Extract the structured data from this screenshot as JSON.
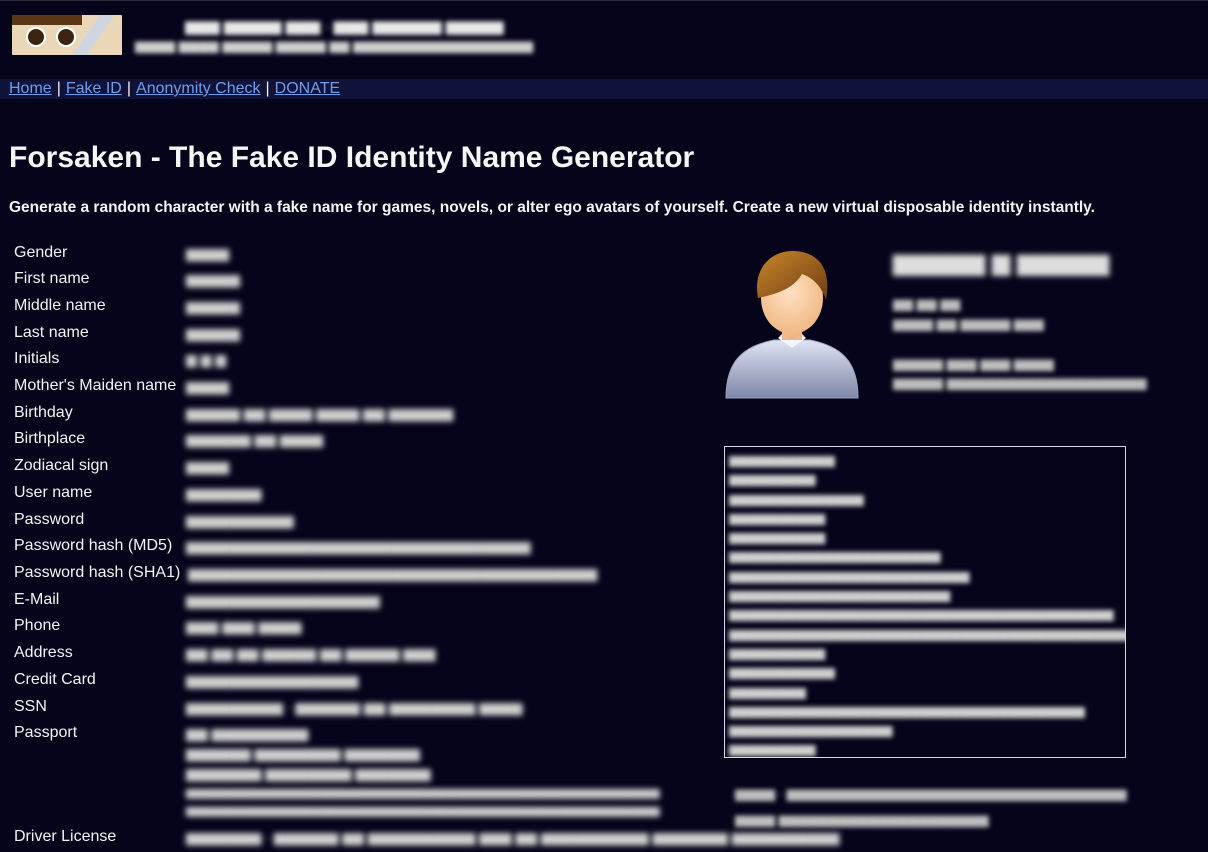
{
  "nav": {
    "links": [
      "Home",
      "Fake ID",
      "Anonymity Check",
      "DONATE"
    ],
    "separator": "|"
  },
  "page": {
    "title": "Forsaken - The Fake ID Identity Name Generator",
    "description": "Generate a random character with a fake name for games, novels, or alter ego avatars of yourself. Create a new virtual disposable identity instantly."
  },
  "fields": [
    {
      "label": "Gender"
    },
    {
      "label": "First name"
    },
    {
      "label": "Middle name"
    },
    {
      "label": "Last name"
    },
    {
      "label": "Initials"
    },
    {
      "label": "Mother's Maiden name"
    },
    {
      "label": "Birthday"
    },
    {
      "label": "Birthplace"
    },
    {
      "label": "Zodiacal sign"
    },
    {
      "label": "User name"
    },
    {
      "label": "Password"
    },
    {
      "label": "Password hash (MD5)"
    },
    {
      "label": "Password hash (SHA1)"
    },
    {
      "label": "E-Mail"
    },
    {
      "label": "Phone"
    },
    {
      "label": "Address"
    },
    {
      "label": "Credit Card"
    },
    {
      "label": "SSN"
    },
    {
      "label": "Passport"
    },
    {
      "label": "Driver License"
    }
  ],
  "icons": {
    "logo": "anime-face-logo-icon",
    "avatar": "person-avatar-icon"
  },
  "colors": {
    "background": "#05041a",
    "nav_background": "#11123a",
    "link": "#6e9ee8",
    "text": "#f4f4f4"
  }
}
